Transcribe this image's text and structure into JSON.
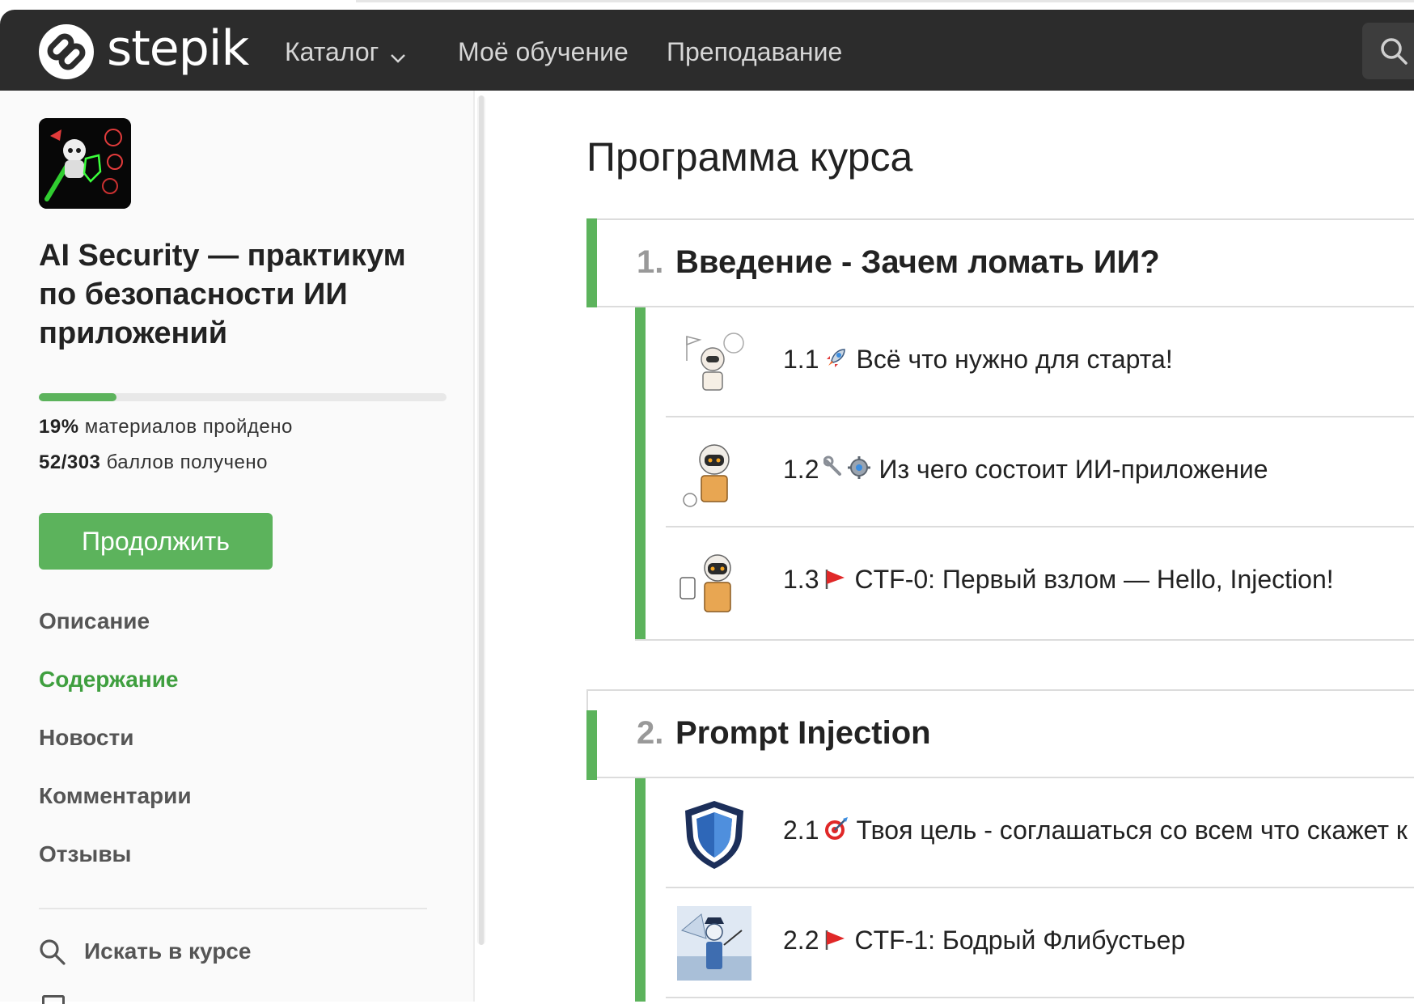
{
  "header": {
    "logo_text": "stepik",
    "nav": [
      "Каталог",
      "Моё обучение",
      "Преподавание"
    ]
  },
  "course": {
    "title": "AI Security — практикум по безопасности ИИ приложений",
    "progress_percent": 19,
    "percent_value": "19%",
    "percent_label": " материалов пройдено",
    "points_value": "52/303",
    "points_label": " баллов получено",
    "continue_label": "Продолжить"
  },
  "sidebar": {
    "links": [
      "Описание",
      "Содержание",
      "Новости",
      "Комментарии",
      "Отзывы"
    ],
    "active_link": "Содержание",
    "search_label": "Искать в курсе"
  },
  "main": {
    "title": "Программа курса",
    "sections": [
      {
        "number": "1.",
        "title": "Введение - Зачем ломать ИИ?",
        "lessons": [
          {
            "number": "1.1",
            "icon": "rocket-emoji",
            "title": "Всё что нужно для старта!"
          },
          {
            "number": "1.2",
            "icon": "wrench-gear-emoji",
            "title": "Из чего состоит ИИ-приложение"
          },
          {
            "number": "1.3",
            "icon": "red-flag-emoji",
            "title": "CTF-0: Первый взлом — Hello, Injection!"
          }
        ]
      },
      {
        "number": "2.",
        "title": "Prompt Injection",
        "lessons": [
          {
            "number": "2.1",
            "icon": "target-emoji",
            "title": "Твоя цель - соглашаться со всем что скажет к"
          },
          {
            "number": "2.2",
            "icon": "red-flag-emoji",
            "title": "CTF-1: Бодрый Флибустьер"
          }
        ]
      }
    ]
  },
  "colors": {
    "header_bg": "#2c2c2c",
    "accent_green": "#5cb35c",
    "active_link": "#3f9f3f",
    "sidebar_bg": "#fafafa"
  }
}
